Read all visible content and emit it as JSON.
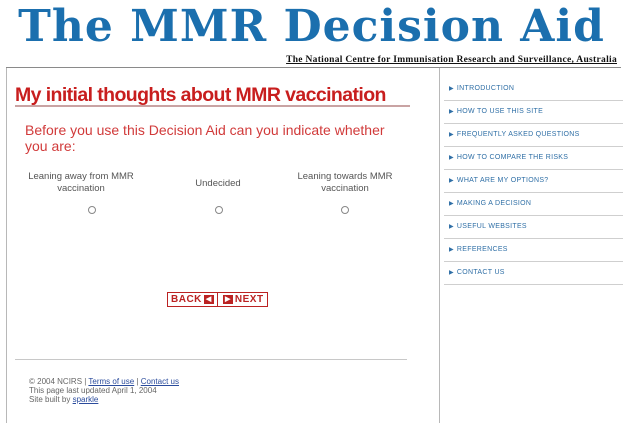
{
  "site": {
    "title": "The MMR Decision Aid",
    "subtitle": "The National Centre for Immunisation Research and Surveillance, Australia"
  },
  "main": {
    "heading": "My initial thoughts about MMR vaccination",
    "intro": "Before you use this Decision Aid can you indicate whether you are:",
    "options": [
      {
        "label": "Leaning away from MMR vaccination"
      },
      {
        "label": "Undecided"
      },
      {
        "label": "Leaning towards MMR vaccination"
      }
    ],
    "back_label": "BACK",
    "next_label": "NEXT"
  },
  "sidebar": {
    "items": [
      {
        "label": "INTRODUCTION"
      },
      {
        "label": "HOW TO USE THIS SITE"
      },
      {
        "label": "FREQUENTLY ASKED QUESTIONS"
      },
      {
        "label": "HOW TO COMPARE THE RISKS"
      },
      {
        "label": "WHAT ARE MY OPTIONS?"
      },
      {
        "label": "MAKING A DECISION"
      },
      {
        "label": "USEFUL WEBSITES"
      },
      {
        "label": "REFERENCES"
      },
      {
        "label": "CONTACT US"
      }
    ]
  },
  "footer": {
    "copyright": "© 2004 NCIRS |",
    "terms": "Terms of use",
    "sep": "|",
    "contact": "Contact us",
    "updated": "This page last updated April 1, 2004",
    "built_by_prefix": "Site built by",
    "built_by": "sparkle"
  },
  "colors": {
    "title": "#1b6fae",
    "heading": "#c81e1e",
    "intro": "#d13a3a",
    "nav_link": "#2f6fa6"
  }
}
